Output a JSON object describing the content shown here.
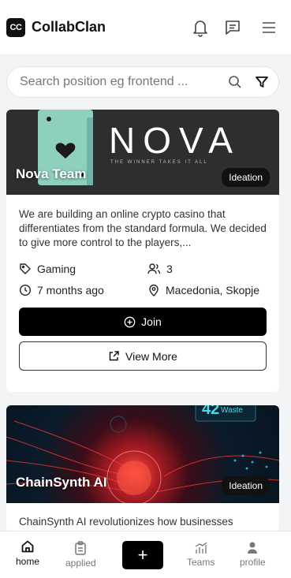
{
  "app": {
    "logo_text": "CC",
    "name": "CollabClan"
  },
  "header": {
    "icons": [
      "bell-icon",
      "message-icon",
      "menu-icon"
    ]
  },
  "search": {
    "placeholder": "Search position eg frontend ...",
    "icons": [
      "search-icon",
      "filter-icon"
    ]
  },
  "teams": [
    {
      "banner_brand": "NOVA",
      "banner_tagline": "THE WINNER TAKES IT ALL",
      "name": "Nova Team",
      "stage": "Ideation",
      "description": "We are building an online crypto casino that differentiates from the standard formula. We decided to give more control to the players,...",
      "category": "Gaming",
      "members": "3",
      "posted": "7 months ago",
      "location": "Macedonia, Skopje",
      "join_label": "Join",
      "view_more_label": "View More"
    },
    {
      "banner_stat": "42",
      "banner_stat_label": "Waste",
      "name": "ChainSynth AI",
      "stage": "Ideation",
      "description": "ChainSynth AI revolutionizes how businesses"
    }
  ],
  "nav": {
    "home": "home",
    "applied": "applied",
    "add": "+",
    "teams": "Teams",
    "profile": "profile"
  },
  "colors": {
    "primary": "#000000",
    "background": "#f3f4f6",
    "card": "#ffffff",
    "banner_teal": "#8ecfbe"
  }
}
